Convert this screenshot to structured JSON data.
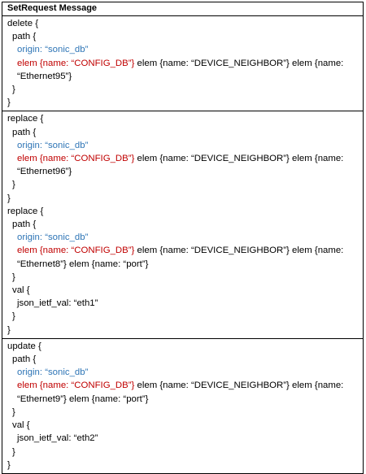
{
  "header": "SetRequest Message",
  "block1": {
    "l1": "delete {",
    "l2": "path {",
    "l3": "origin: “sonic_db”",
    "l4a": "elem {name: “CONFIG_DB”}",
    "l4b": " elem {name: “DEVICE_NEIGHBOR”} elem {name: “Ethernet95”}",
    "l5": "}",
    "l6": "}"
  },
  "block2": {
    "l1": "replace {",
    "l2": "path {",
    "l3": "origin: “sonic_db”",
    "l4a": "elem {name: “CONFIG_DB”}",
    "l4b": " elem {name: “DEVICE_NEIGHBOR”} elem {name: “Ethernet96”}",
    "l5": "}",
    "l6": "}",
    "l7": "replace {",
    "l8": "path {",
    "l9": "origin: “sonic_db”",
    "l10a": "elem {name: “CONFIG_DB”}",
    "l10b": " elem {name: “DEVICE_NEIGHBOR”} elem {name: “Ethernet8”} elem {name: “port”}",
    "l11": "}",
    "l12": "val {",
    "l13": "json_ietf_val: “eth1”",
    "l14": "}",
    "l15": "}"
  },
  "block3": {
    "l1": "update {",
    "l2": "path {",
    "l3": "origin: “sonic_db”",
    "l4a": "elem {name: “CONFIG_DB”}",
    "l4b": " elem {name: “DEVICE_NEIGHBOR”} elem {name: “Ethernet9”} elem {name: “port”}",
    "l5": "}",
    "l6": "val {",
    "l7": "json_ietf_val: “eth2”",
    "l8": "}",
    "l9": "}"
  }
}
